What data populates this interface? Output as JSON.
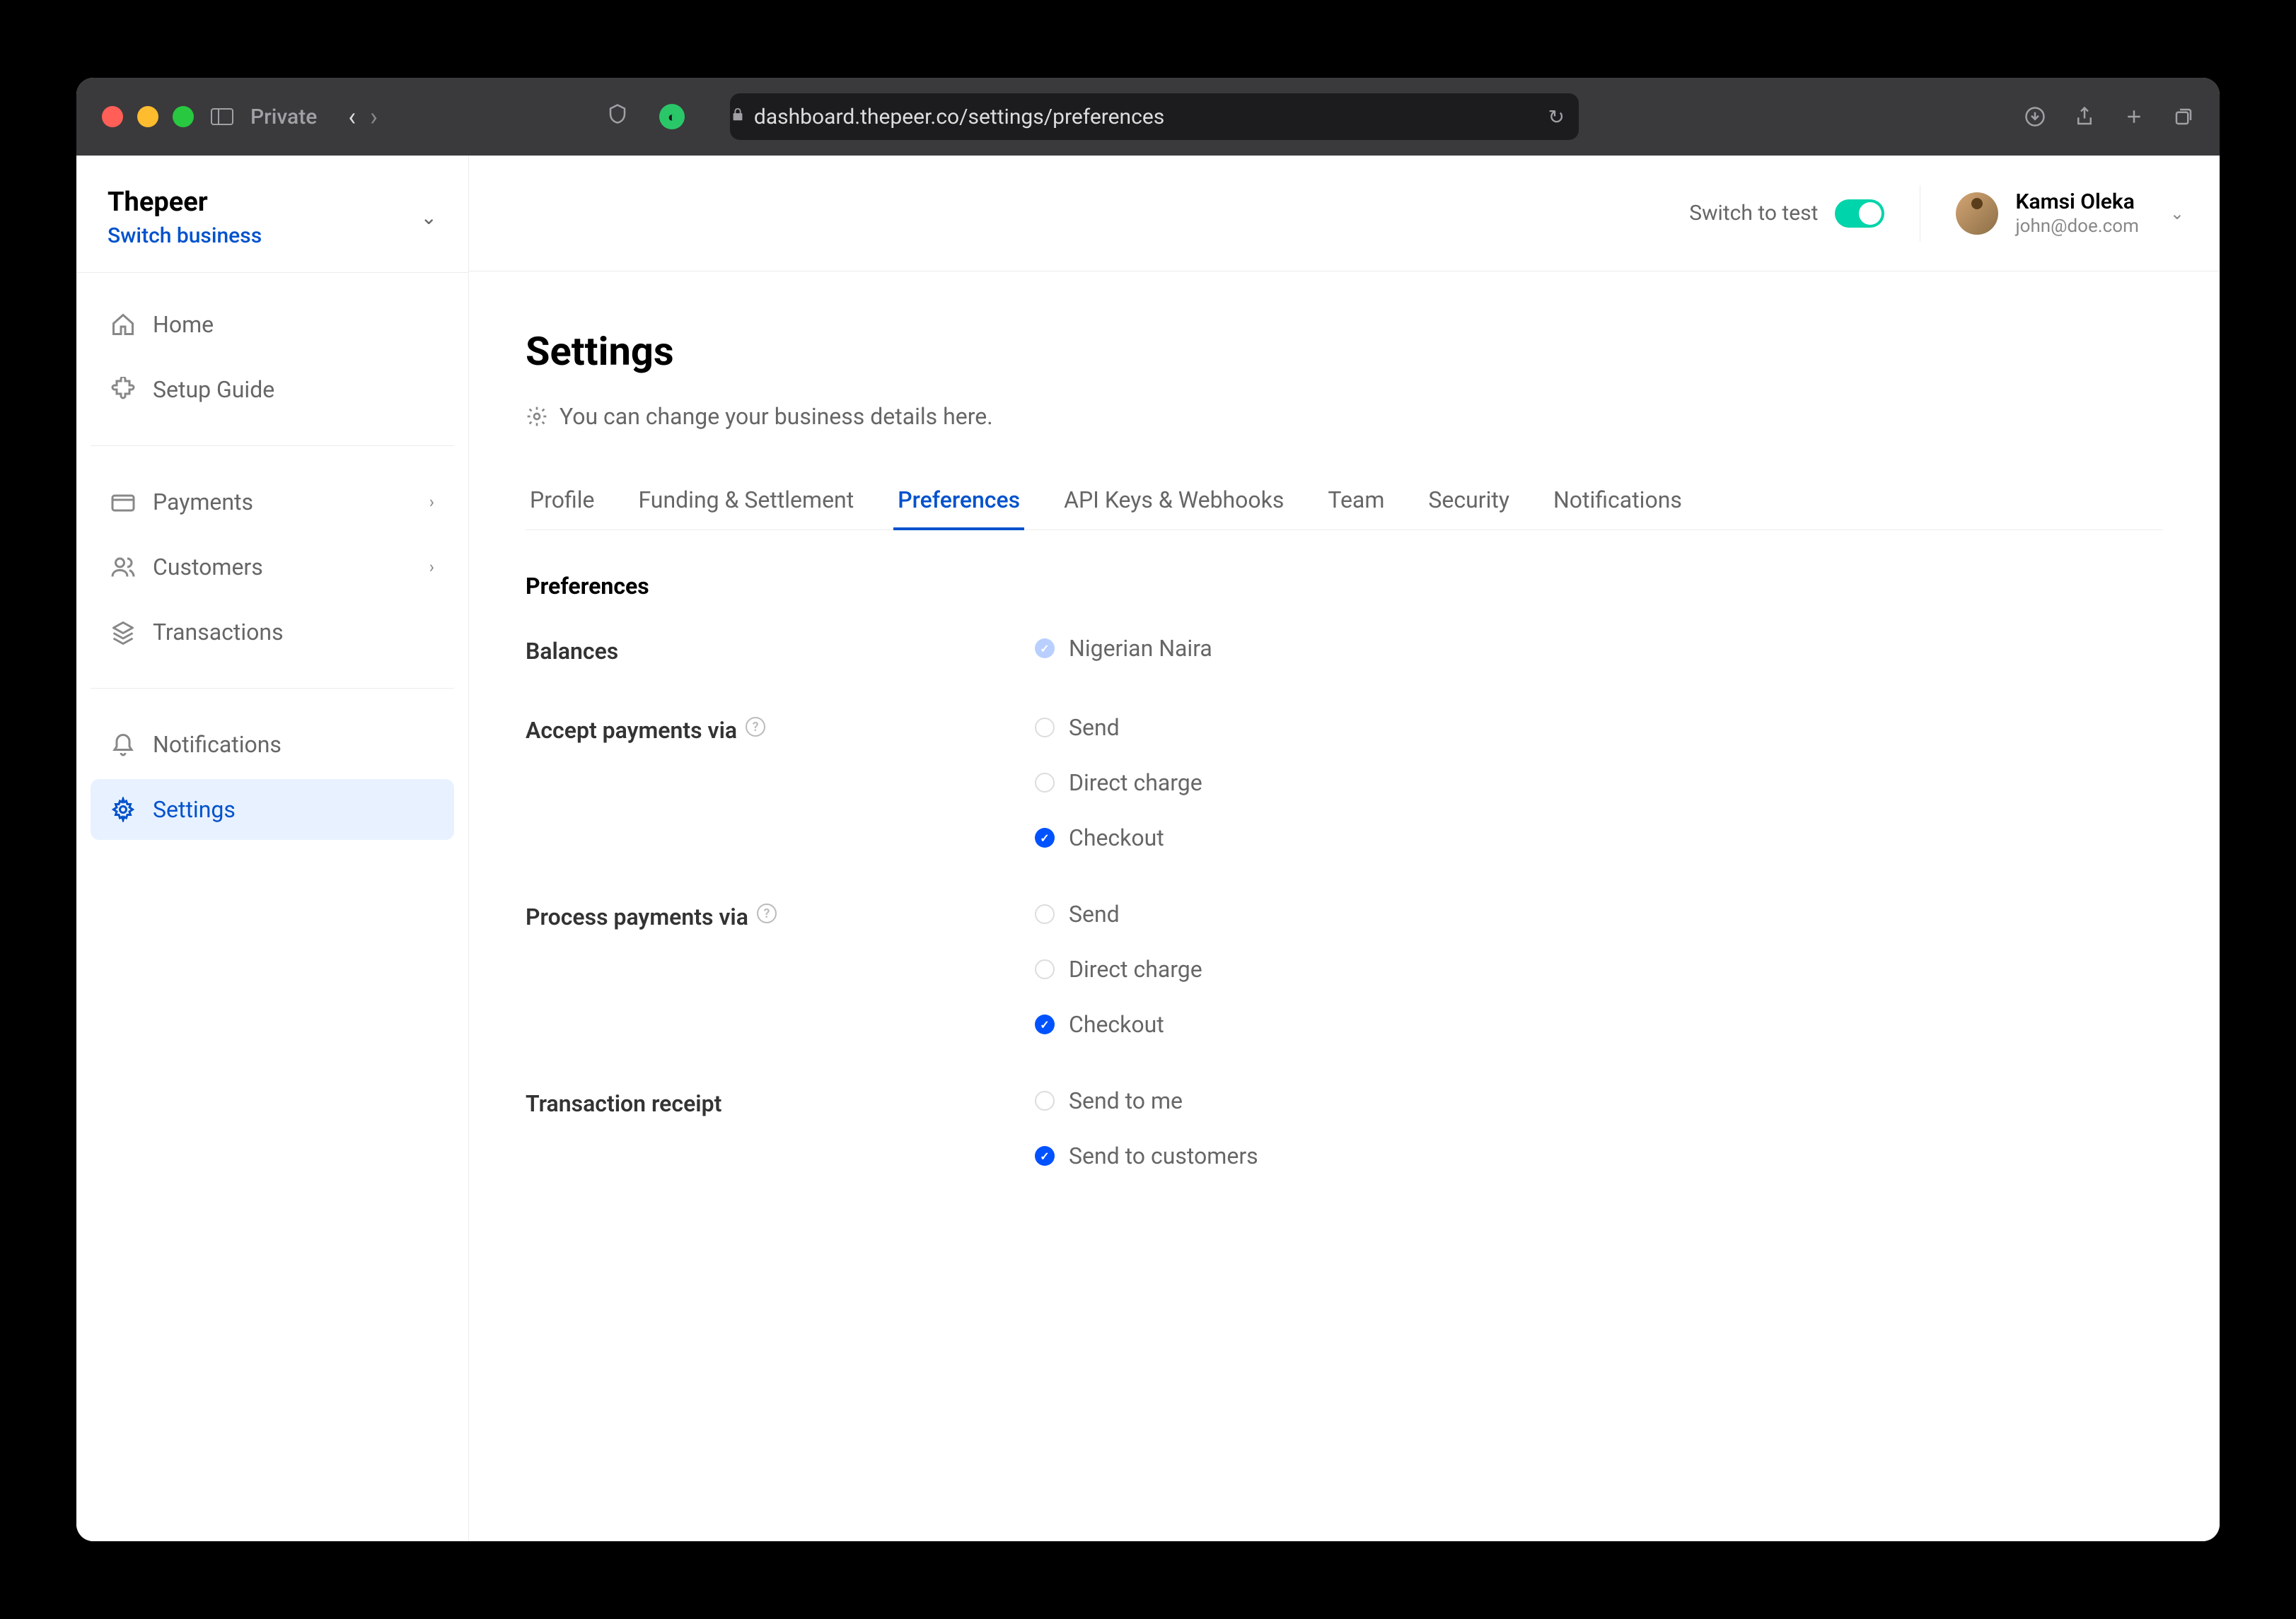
{
  "chrome": {
    "private_label": "Private",
    "url": "dashboard.thepeer.co/settings/preferences"
  },
  "sidebar": {
    "brand": "Thepeer",
    "switch_label": "Switch business",
    "items": [
      {
        "label": "Home",
        "icon": "home"
      },
      {
        "label": "Setup Guide",
        "icon": "puzzle"
      },
      {
        "label": "Payments",
        "icon": "card",
        "chevron": true
      },
      {
        "label": "Customers",
        "icon": "users",
        "chevron": true
      },
      {
        "label": "Transactions",
        "icon": "layers"
      },
      {
        "label": "Notifications",
        "icon": "bell"
      },
      {
        "label": "Settings",
        "icon": "gear",
        "active": true
      }
    ]
  },
  "topbar": {
    "test_label": "Switch to test",
    "user_name": "Kamsi Oleka",
    "user_email": "john@doe.com"
  },
  "page": {
    "title": "Settings",
    "description": "You can change your business details here.",
    "tabs": [
      {
        "label": "Profile"
      },
      {
        "label": "Funding & Settlement"
      },
      {
        "label": "Preferences",
        "active": true
      },
      {
        "label": "API Keys & Webhooks"
      },
      {
        "label": "Team"
      },
      {
        "label": "Security"
      },
      {
        "label": "Notifications"
      }
    ],
    "section_title": "Preferences",
    "groups": [
      {
        "label": "Balances",
        "help": false,
        "options": [
          {
            "label": "Nigerian Naira",
            "state": "checked-light"
          }
        ]
      },
      {
        "label": "Accept payments via",
        "help": true,
        "options": [
          {
            "label": "Send",
            "state": "unchecked"
          },
          {
            "label": "Direct charge",
            "state": "unchecked"
          },
          {
            "label": "Checkout",
            "state": "checked"
          }
        ]
      },
      {
        "label": "Process payments via",
        "help": true,
        "options": [
          {
            "label": "Send",
            "state": "unchecked"
          },
          {
            "label": "Direct charge",
            "state": "unchecked"
          },
          {
            "label": "Checkout",
            "state": "checked"
          }
        ]
      },
      {
        "label": "Transaction receipt",
        "help": false,
        "options": [
          {
            "label": "Send to me",
            "state": "unchecked"
          },
          {
            "label": "Send to customers",
            "state": "checked"
          }
        ]
      }
    ]
  }
}
